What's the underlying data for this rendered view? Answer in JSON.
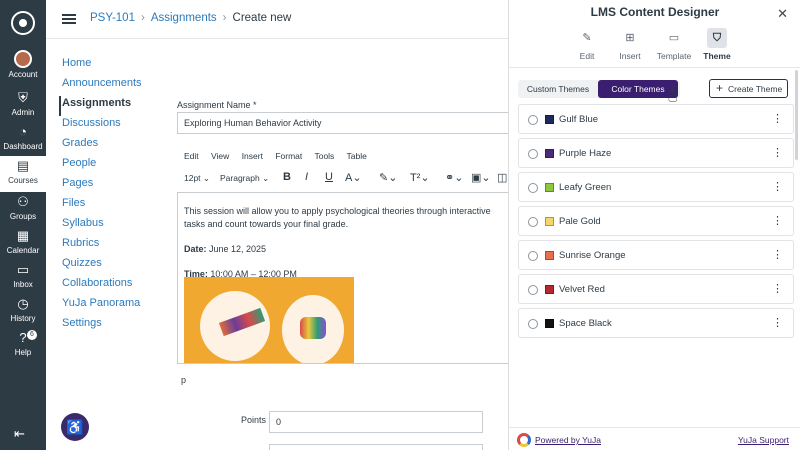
{
  "global_nav": {
    "items": [
      {
        "label": "Account"
      },
      {
        "label": "Admin"
      },
      {
        "label": "Dashboard"
      },
      {
        "label": "Courses"
      },
      {
        "label": "Groups"
      },
      {
        "label": "Calendar"
      },
      {
        "label": "Inbox"
      },
      {
        "label": "History"
      },
      {
        "label": "Help",
        "badge": "6"
      }
    ]
  },
  "breadcrumb": {
    "course": "PSY-101",
    "section": "Assignments",
    "current": "Create new"
  },
  "course_nav": [
    "Home",
    "Announcements",
    "Assignments",
    "Discussions",
    "Grades",
    "People",
    "Pages",
    "Files",
    "Syllabus",
    "Rubrics",
    "Quizzes",
    "Collaborations",
    "YuJa Panorama",
    "Settings"
  ],
  "form": {
    "name_label": "Assignment Name *",
    "name_value": "Exploring Human Behavior Activity",
    "menu": [
      "Edit",
      "View",
      "Insert",
      "Format",
      "Tools",
      "Table"
    ],
    "toolbar": {
      "font_size": "12pt",
      "block": "Paragraph"
    },
    "body_text": "This session will allow you to apply psychological theories through interactive tasks and count towards your final grade.",
    "date_label": "Date:",
    "date_value": " June 12, 2025",
    "time_label": "Time:",
    "time_value": " 10:00 AM – 12:00 PM",
    "path": "p",
    "points_label": "Points",
    "points_value": "0"
  },
  "panel": {
    "title": "LMS Content Designer",
    "tabs": [
      {
        "label": "Edit"
      },
      {
        "label": "Insert"
      },
      {
        "label": "Template"
      },
      {
        "label": "Theme"
      }
    ],
    "segments": {
      "custom": "Custom Themes",
      "color": "Color Themes"
    },
    "create_label": "Create Theme",
    "themes": [
      {
        "name": "Gulf Blue",
        "color": "#1c2a5e"
      },
      {
        "name": "Purple Haze",
        "color": "#4b2a7b"
      },
      {
        "name": "Leafy Green",
        "color": "#8dc63f"
      },
      {
        "name": "Pale Gold",
        "color": "#f6d56b"
      },
      {
        "name": "Sunrise Orange",
        "color": "#e56f4e"
      },
      {
        "name": "Velvet Red",
        "color": "#b5282f"
      },
      {
        "name": "Space Black",
        "color": "#111111"
      }
    ],
    "footer": {
      "powered": "Powered by YuJa",
      "support": "YuJa Support"
    }
  }
}
